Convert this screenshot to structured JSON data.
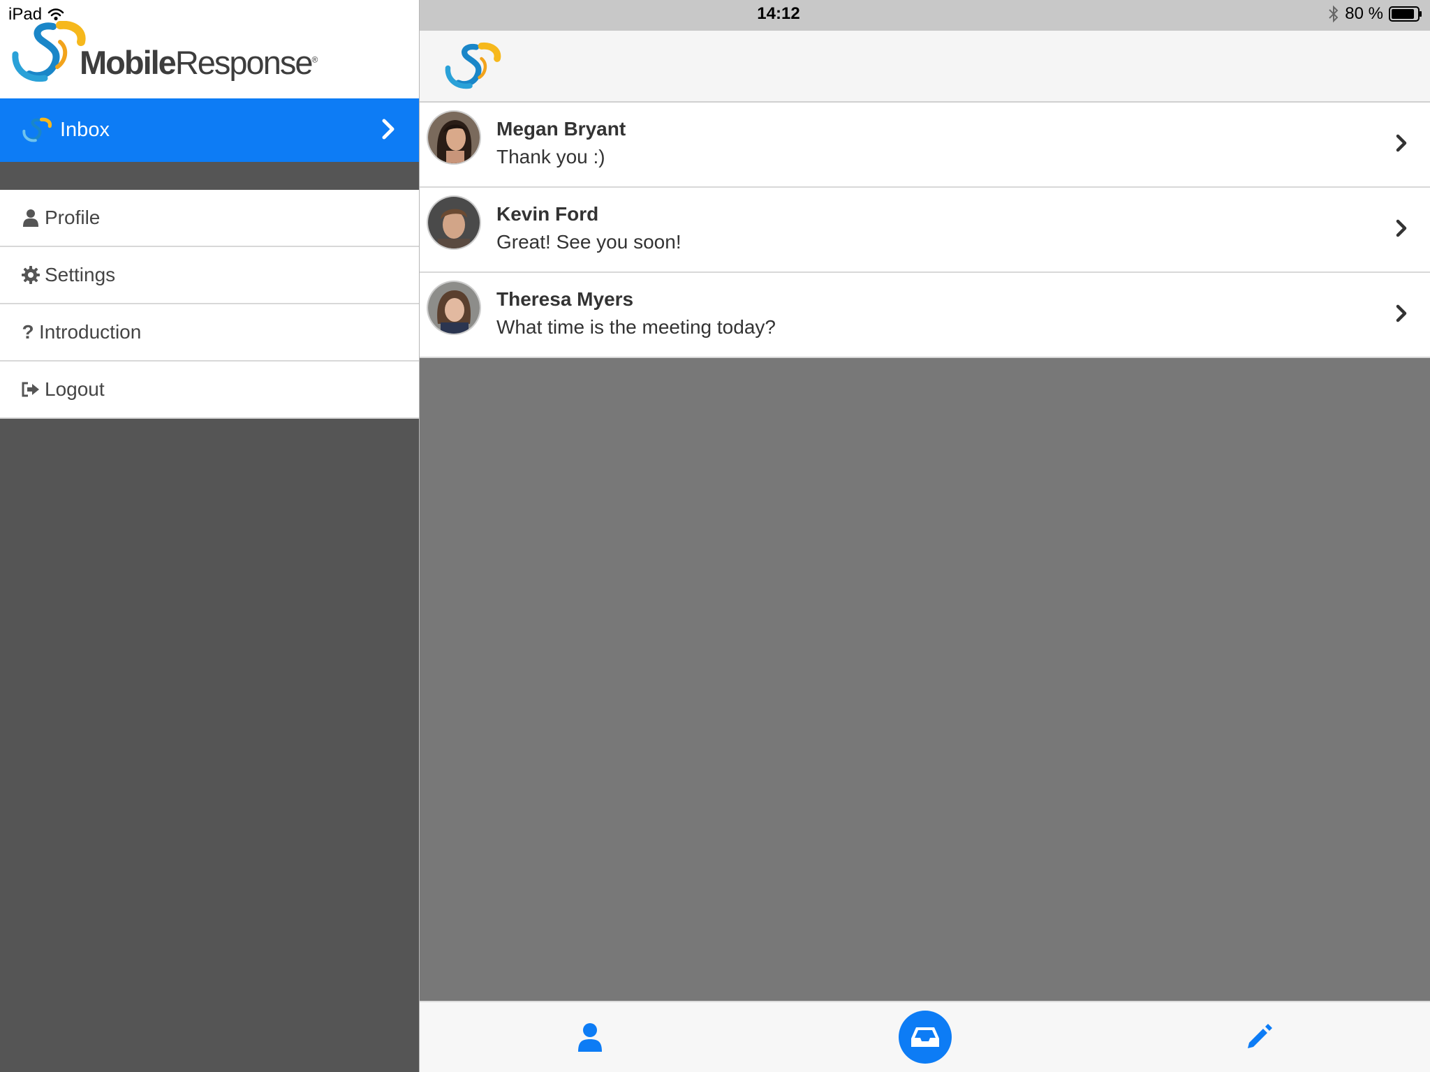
{
  "status_bar": {
    "device": "iPad",
    "time": "14:12",
    "battery": "80 %"
  },
  "brand": {
    "name_bold": "Mobile",
    "name_regular": "Response",
    "reg_mark": "®"
  },
  "sidebar": {
    "inbox_label": "Inbox",
    "items": [
      {
        "label": "Profile",
        "icon": "user-icon"
      },
      {
        "label": "Settings",
        "icon": "gear-icon"
      },
      {
        "label": "Introduction",
        "icon": "question-icon"
      },
      {
        "label": "Logout",
        "icon": "logout-icon"
      }
    ]
  },
  "messages": [
    {
      "name": "Megan Bryant",
      "preview": "Thank you :)"
    },
    {
      "name": "Kevin Ford",
      "preview": "Great! See you soon!"
    },
    {
      "name": "Theresa Myers",
      "preview": "What time is the meeting today?"
    }
  ],
  "tabbar": {
    "tabs": [
      "user-icon",
      "inbox-tray-icon",
      "pencil-icon"
    ],
    "active": "inbox-tray-icon"
  },
  "colors": {
    "accent": "#0d7cf5",
    "sidebar_bg": "#555555",
    "main_bg": "#787878",
    "logo_yellow": "#f6b81c",
    "logo_blue": "#1a86c8"
  }
}
